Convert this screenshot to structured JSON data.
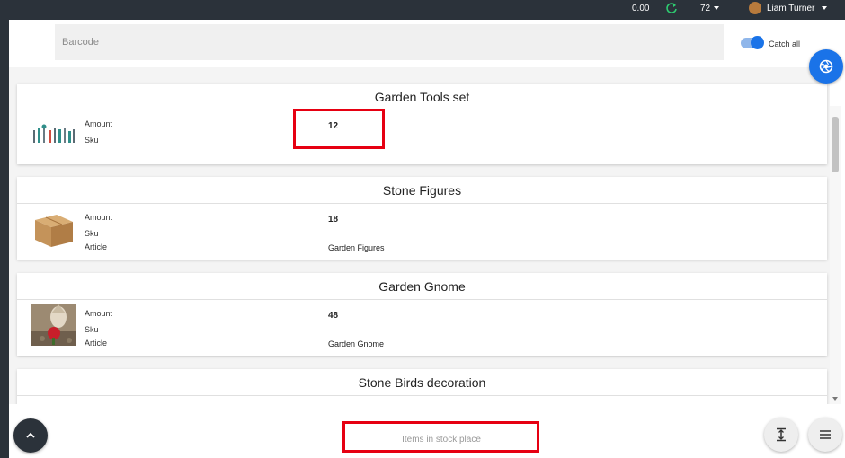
{
  "topbar": {
    "balance": "0.00",
    "count": "72",
    "user_name": "Liam Turner",
    "icons": [
      "refresh-icon",
      "chevron-down-icon",
      "avatar"
    ]
  },
  "scan": {
    "barcode_placeholder": "Barcode",
    "catch_all_label": "Catch all",
    "catch_all_enabled": true
  },
  "items": [
    {
      "title": "Garden Tools set",
      "amount_label": "Amount",
      "amount": "12",
      "sku_label": "Sku",
      "sku": "",
      "image": "garden-tools-image"
    },
    {
      "title": "Stone Figures",
      "amount_label": "Amount",
      "amount": "18",
      "sku_label": "Sku",
      "sku": "",
      "article_label": "Article",
      "article": "Garden Figures",
      "image": "cardboard-box-image"
    },
    {
      "title": "Garden Gnome",
      "amount_label": "Amount",
      "amount": "48",
      "sku_label": "Sku",
      "sku": "",
      "article_label": "Article",
      "article": "Garden Gnome",
      "image": "garden-gnome-image"
    },
    {
      "title": "Stone Birds decoration"
    }
  ],
  "footer": {
    "stock_place_label": "Items in stock place",
    "icons": [
      "chevron-up-icon",
      "collapse-vertical-icon",
      "menu-icon",
      "camera-shutter-icon"
    ]
  },
  "colors": {
    "topbar_bg": "#2b323a",
    "accent": "#1a73e8",
    "highlight": "#e60012"
  }
}
